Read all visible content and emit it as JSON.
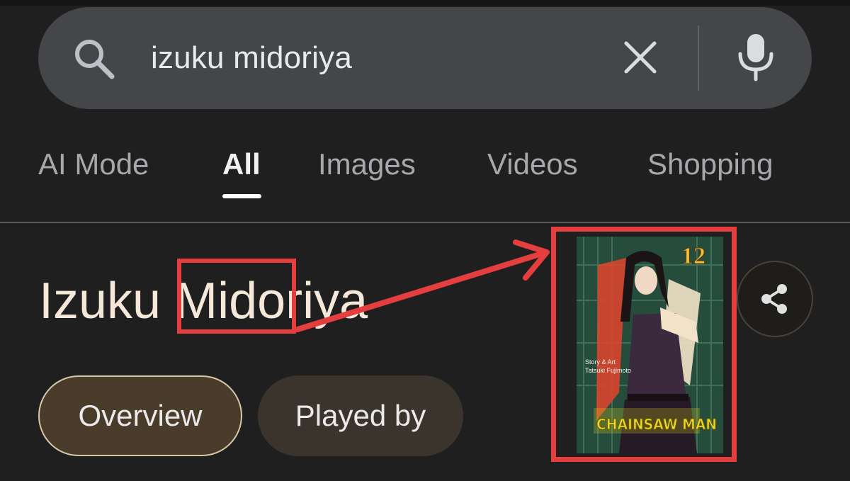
{
  "search": {
    "query": "izuku midoriya",
    "icons": {
      "search": "search-icon",
      "clear": "close-icon",
      "mic": "microphone-icon"
    }
  },
  "tabs": [
    {
      "label": "AI Mode",
      "active": false
    },
    {
      "label": "All",
      "active": true
    },
    {
      "label": "Images",
      "active": false
    },
    {
      "label": "Videos",
      "active": false
    },
    {
      "label": "Shopping",
      "active": false
    }
  ],
  "entity": {
    "title_prefix": "Izuku ",
    "title_highlight": "Mid",
    "title_suffix": "oriya"
  },
  "chips": [
    {
      "label": "Overview",
      "selected": true
    },
    {
      "label": "Played by",
      "selected": false
    }
  ],
  "share": {
    "icon": "share-icon"
  },
  "cover": {
    "volume": "12",
    "credit_line1": "Story & Art",
    "credit_line2": "Tatsuki Fujimoto",
    "logo_text": "CHAINSAW MAN"
  },
  "annotation": {
    "color": "#e53e3e"
  },
  "colors": {
    "background": "#1f1f1f",
    "search_bar": "#44464a",
    "title_text": "#f6e8d8",
    "chip_selected": "#4a3c2a"
  }
}
